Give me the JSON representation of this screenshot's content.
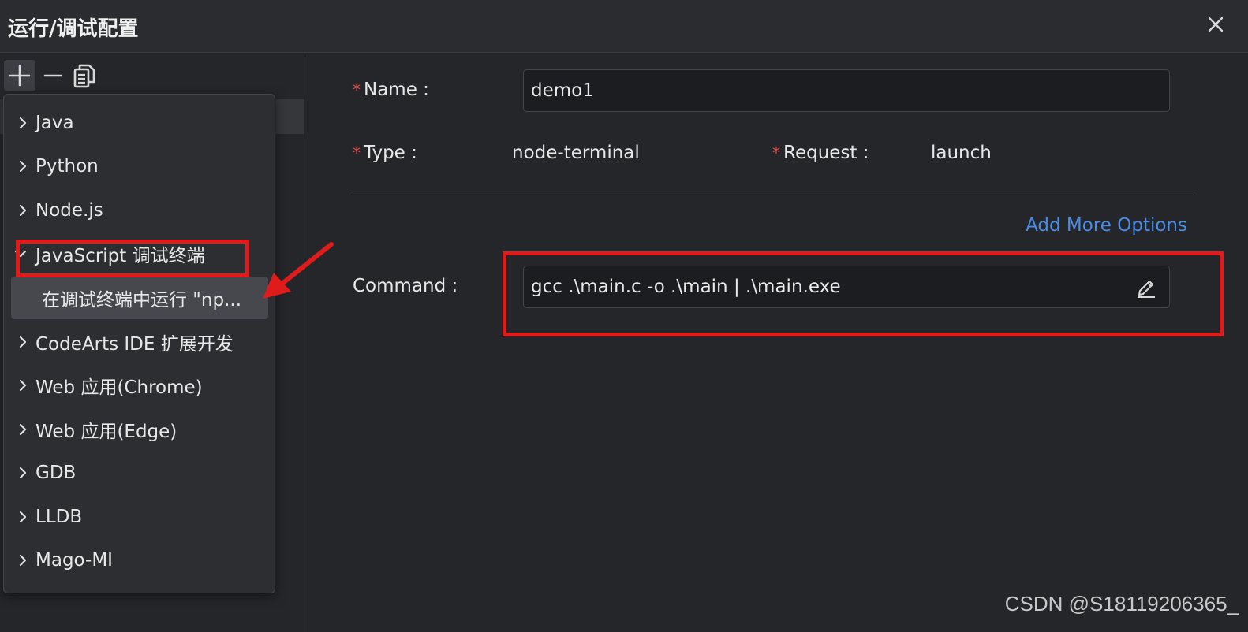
{
  "title": "运行/调试配置",
  "close_icon": "close-icon",
  "toolbar": {
    "add_icon": "plus-icon",
    "remove_icon": "minus-icon",
    "copy_icon": "copy-icon"
  },
  "dropdown": {
    "items": [
      {
        "label": "Java",
        "expanded": false
      },
      {
        "label": "Python",
        "expanded": false
      },
      {
        "label": "Node.js",
        "expanded": false
      },
      {
        "label": "JavaScript 调试终端",
        "expanded": true
      },
      {
        "label": "CodeArts IDE 扩展开发",
        "expanded": false
      },
      {
        "label": "Web 应用(Chrome)",
        "expanded": false
      },
      {
        "label": "Web 应用(Edge)",
        "expanded": false
      },
      {
        "label": "GDB",
        "expanded": false
      },
      {
        "label": "LLDB",
        "expanded": false
      },
      {
        "label": "Mago-MI",
        "expanded": false
      }
    ],
    "subitem": "在调试终端中运行 \"np..."
  },
  "form": {
    "required_mark": "*",
    "name_label": "Name :",
    "name_value": "demo1",
    "type_label": "Type :",
    "type_value": "node-terminal",
    "request_label": "Request :",
    "request_value": "launch",
    "add_more_options": "Add More Options",
    "command_label": "Command :",
    "command_value": "gcc .\\main.c -o .\\main | .\\main.exe"
  },
  "annotation_color": "#e01b1b",
  "link_color": "#4a8de8",
  "watermark": "CSDN @S18119206365_"
}
